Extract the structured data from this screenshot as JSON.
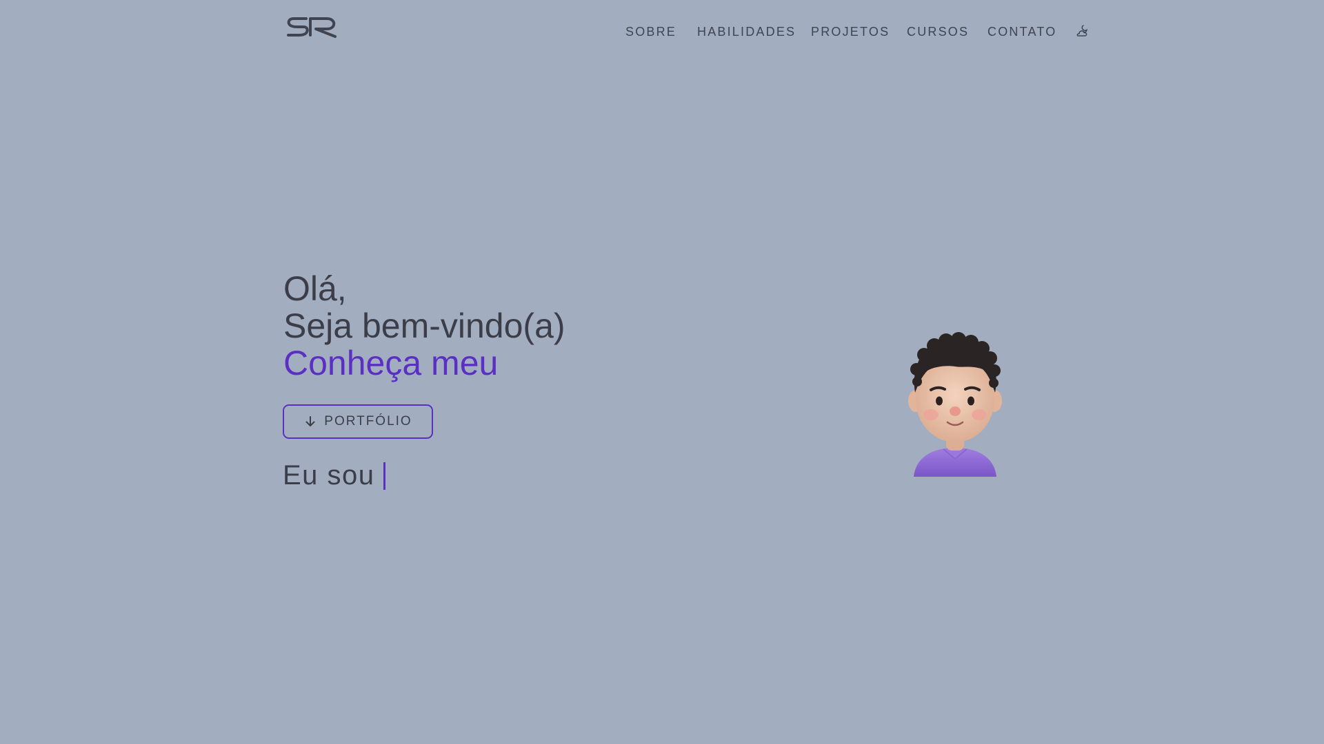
{
  "header": {
    "logo_text": "SR",
    "nav": [
      {
        "label": "SOBRE"
      },
      {
        "label": "HABILIDADES"
      },
      {
        "label": "PROJETOS"
      },
      {
        "label": "CURSOS"
      },
      {
        "label": "CONTATO"
      }
    ],
    "theme_toggle_icon": "moon-cloud-icon"
  },
  "hero": {
    "line1": "Olá,",
    "line2": "Seja bem-vindo(a)",
    "line3": "Conheça meu",
    "button_label": "PORTFÓLIO",
    "button_icon": "arrow-down-icon",
    "typing_text": "Eu sou"
  },
  "colors": {
    "background": "#a2aec0",
    "accent": "#5b2fc4",
    "text": "#3b3e49"
  }
}
